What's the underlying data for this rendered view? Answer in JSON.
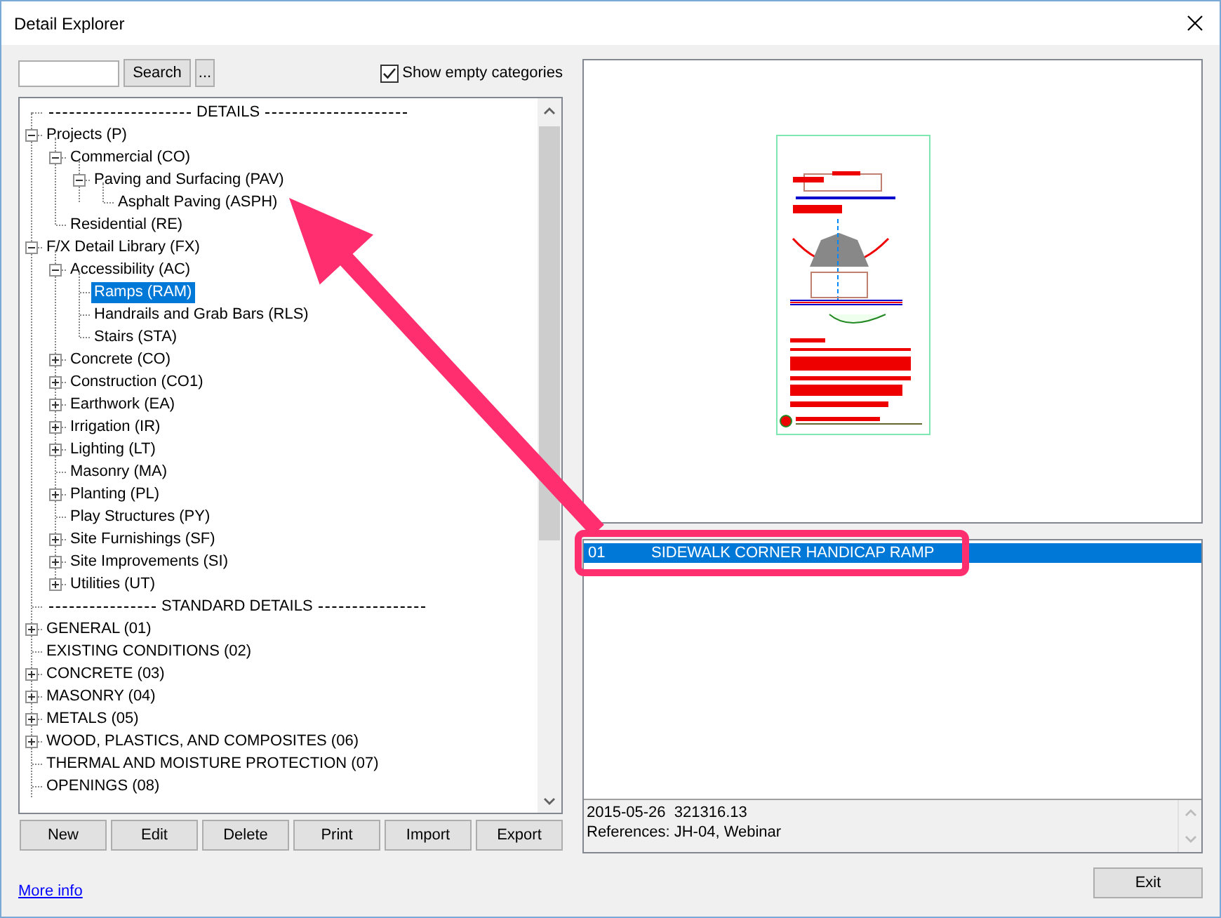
{
  "window": {
    "title": "Detail Explorer"
  },
  "search": {
    "button": "Search",
    "more_button": "..."
  },
  "show_empty_categories": {
    "label": "Show empty categories",
    "checked": true
  },
  "tree": [
    {
      "kind": "separator",
      "label": "DETAILS"
    },
    {
      "kind": "node",
      "label": "Projects (P)",
      "selected": false,
      "expanded": true,
      "children": [
        {
          "kind": "node",
          "label": "Commercial (CO)",
          "selected": false,
          "expanded": true,
          "children": [
            {
              "kind": "node",
              "label": "Paving and Surfacing (PAV)",
              "selected": false,
              "expanded": true,
              "children": [
                {
                  "kind": "node",
                  "label": "Asphalt Paving (ASPH)",
                  "selected": false
                }
              ]
            }
          ]
        },
        {
          "kind": "node",
          "label": "Residential (RE)",
          "selected": false
        }
      ]
    },
    {
      "kind": "node",
      "label": "F/X Detail Library (FX)",
      "selected": false,
      "expanded": true,
      "children": [
        {
          "kind": "node",
          "label": "Accessibility (AC)",
          "selected": false,
          "expanded": true,
          "children": [
            {
              "kind": "node",
              "label": "Ramps (RAM)",
              "selected": true
            },
            {
              "kind": "node",
              "label": "Handrails and Grab Bars (RLS)",
              "selected": false
            },
            {
              "kind": "node",
              "label": "Stairs (STA)",
              "selected": false
            }
          ]
        },
        {
          "kind": "node",
          "label": "Concrete (CO)",
          "selected": false,
          "expanded": false
        },
        {
          "kind": "node",
          "label": "Construction (CO1)",
          "selected": false,
          "expanded": false
        },
        {
          "kind": "node",
          "label": "Earthwork (EA)",
          "selected": false,
          "expanded": false
        },
        {
          "kind": "node",
          "label": "Irrigation (IR)",
          "selected": false,
          "expanded": false
        },
        {
          "kind": "node",
          "label": "Lighting (LT)",
          "selected": false,
          "expanded": false
        },
        {
          "kind": "node",
          "label": "Masonry (MA)",
          "selected": false
        },
        {
          "kind": "node",
          "label": "Planting (PL)",
          "selected": false,
          "expanded": false
        },
        {
          "kind": "node",
          "label": "Play Structures (PY)",
          "selected": false
        },
        {
          "kind": "node",
          "label": "Site Furnishings (SF)",
          "selected": false,
          "expanded": false
        },
        {
          "kind": "node",
          "label": "Site Improvements (SI)",
          "selected": false,
          "expanded": false
        },
        {
          "kind": "node",
          "label": "Utilities (UT)",
          "selected": false,
          "expanded": false
        }
      ]
    },
    {
      "kind": "separator",
      "label": "STANDARD DETAILS"
    },
    {
      "kind": "node",
      "label": "GENERAL (01)",
      "selected": false,
      "expanded": false
    },
    {
      "kind": "node",
      "label": "EXISTING CONDITIONS (02)",
      "selected": false
    },
    {
      "kind": "node",
      "label": "CONCRETE (03)",
      "selected": false,
      "expanded": false
    },
    {
      "kind": "node",
      "label": "MASONRY (04)",
      "selected": false,
      "expanded": false
    },
    {
      "kind": "node",
      "label": "METALS (05)",
      "selected": false,
      "expanded": false
    },
    {
      "kind": "node",
      "label": "WOOD, PLASTICS, AND COMPOSITES (06)",
      "selected": false,
      "expanded": false
    },
    {
      "kind": "node",
      "label": "THERMAL AND MOISTURE PROTECTION (07)",
      "selected": false
    },
    {
      "kind": "node",
      "label": "OPENINGS (08)",
      "selected": false
    }
  ],
  "buttons": [
    "New",
    "Edit",
    "Delete",
    "Print",
    "Import",
    "Export"
  ],
  "more_info_link": "More info",
  "details_list": [
    {
      "number": "01",
      "title": "SIDEWALK CORNER HANDICAP RAMP",
      "selected": true
    }
  ],
  "info_lines": [
    "2015-05-26  321316.13",
    "References: JH-04, Webinar"
  ],
  "exit_button": "Exit"
}
